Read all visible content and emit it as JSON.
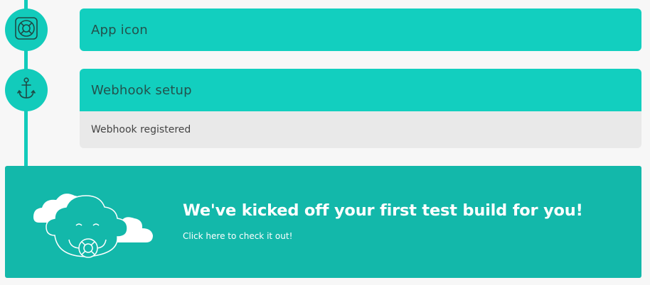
{
  "steps": [
    {
      "title": "App icon",
      "icon": "lifebuoy-icon"
    },
    {
      "title": "Webhook setup",
      "icon": "anchor-icon",
      "status": "Webhook registered"
    }
  ],
  "banner": {
    "title": "We've kicked off your first test build for you!",
    "subtitle": "Click here to check it out!",
    "illustration": "cloud-mascot-illustration"
  },
  "colors": {
    "accent": "#12cbbb",
    "banner": "#13b8aa",
    "header_text": "#23524d",
    "page_bg": "#f7f7f7",
    "status_bg": "#e9e9e9"
  }
}
